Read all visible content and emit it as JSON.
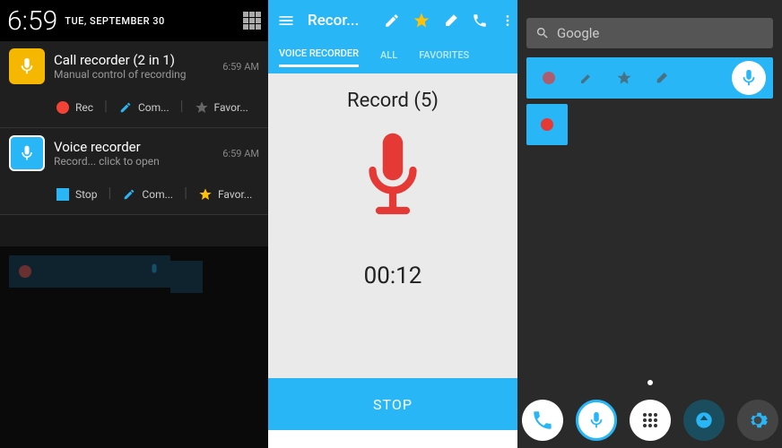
{
  "status": {
    "time": "6:59",
    "date": "TUE, SEPTEMBER 30"
  },
  "notifications": [
    {
      "title": "Call recorder (2 in 1)",
      "subtitle": "Manual control of recording",
      "time": "6:59 AM",
      "actions": [
        {
          "label": "Rec"
        },
        {
          "label": "Com..."
        },
        {
          "label": "Favor..."
        }
      ]
    },
    {
      "title": "Voice recorder",
      "subtitle": "Record... click to open",
      "time": "6:59 AM",
      "actions": [
        {
          "label": "Stop"
        },
        {
          "label": "Com..."
        },
        {
          "label": "Favor..."
        }
      ]
    }
  ],
  "app": {
    "title": "Recor...",
    "tabs": {
      "voice": "VOICE RECORDER",
      "all": "ALL",
      "fav": "FAVORITES"
    },
    "record_label": "Record (5)",
    "timer": "00:12",
    "stop": "STOP"
  },
  "home": {
    "search_placeholder": "Google"
  },
  "colors": {
    "accent": "#29b6f6",
    "record": "#f44336",
    "star": "#ffc107"
  }
}
